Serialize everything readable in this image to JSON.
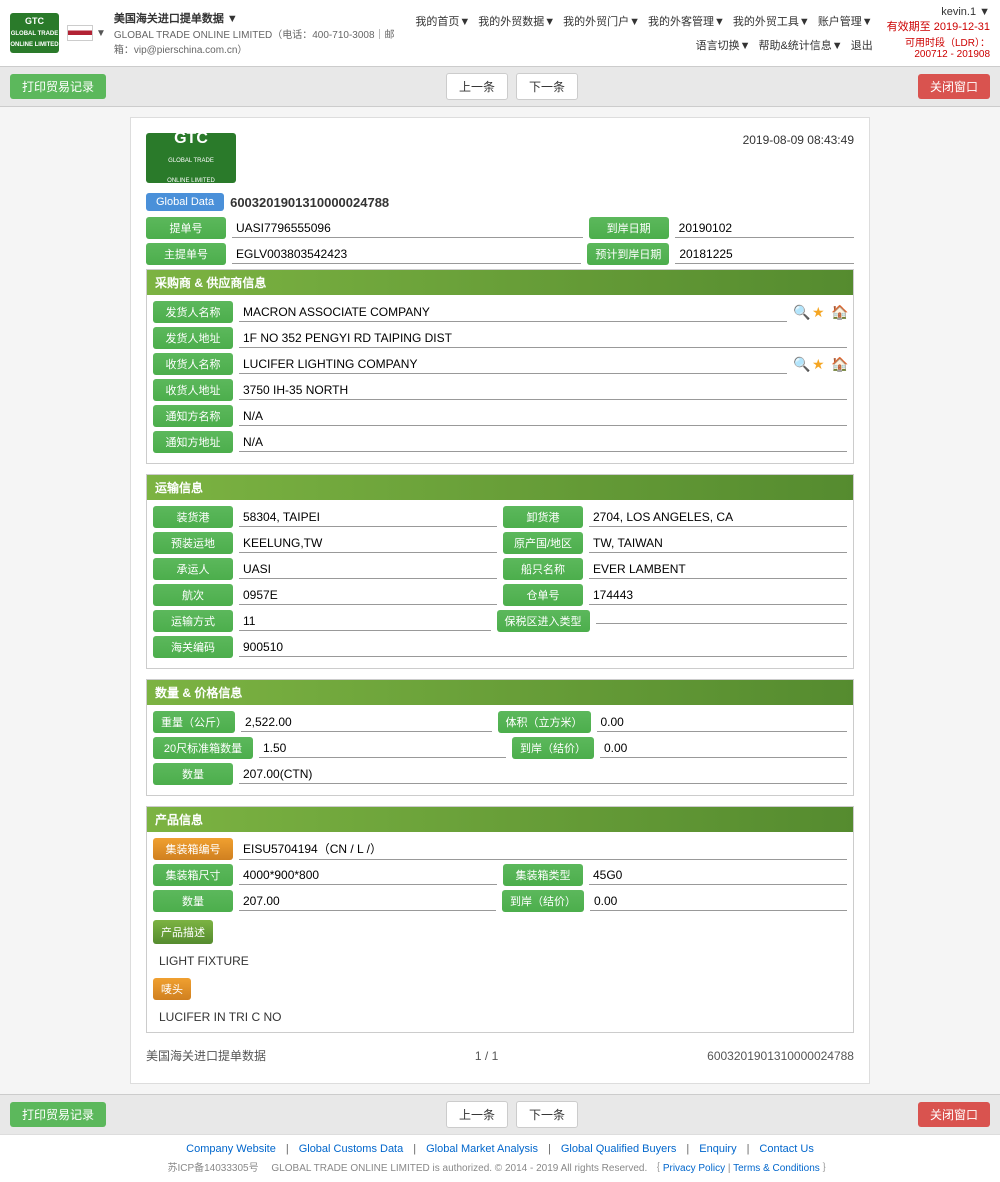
{
  "header": {
    "logo_line1": "GLOBAL TRADE",
    "logo_line2": "ONLINE LIMITED",
    "company_info": "GLOBAL TRADE ONLINE LIMITED（电话：400-710-3008｜邮箱：vip@pierschina.com.cn）",
    "page_title": "美国海关进口提单数据 ▼",
    "account": "kevin.1 ▼",
    "validity": "有效期至 2019-12-31",
    "ldr": "可用时段（LDR）：200712 - 201908",
    "flag_alt": "US Flag"
  },
  "nav": {
    "items": [
      "我的首页▼",
      "我的外贸数据▼",
      "我的外贸门户▼",
      "我的外客管理▼",
      "我的外贸工具▼",
      "账户管理▼",
      "语言切换▼",
      "帮助&统计信息▼",
      "退出"
    ]
  },
  "toolbar": {
    "print_btn": "打印贸易记录",
    "prev_btn": "上一条",
    "next_btn": "下一条",
    "close_btn": "关闭窗口"
  },
  "doc": {
    "timestamp": "2019-08-09 08:43:49",
    "logo_line1": "GTC",
    "logo_line2": "GLOBAL TRADE ONLINE LIMITED",
    "global_data_label": "Global Data",
    "global_data_value": "6003201901310000024788",
    "bill_no_label": "提单号",
    "bill_no_value": "UASI7796555096",
    "arrival_date_label": "到岸日期",
    "arrival_date_value": "20190102",
    "main_bill_label": "主提单号",
    "main_bill_value": "EGLV003803542423",
    "est_arrival_label": "预计到岸日期",
    "est_arrival_value": "20181225"
  },
  "buyer_supplier": {
    "section_title": "采购商 & 供应商信息",
    "shipper_name_label": "发货人名称",
    "shipper_name_value": "MACRON ASSOCIATE COMPANY",
    "shipper_addr_label": "发货人地址",
    "shipper_addr_value": "1F NO 352 PENGYI RD TAIPING DIST",
    "consignee_name_label": "收货人名称",
    "consignee_name_value": "LUCIFER LIGHTING COMPANY",
    "consignee_addr_label": "收货人地址",
    "consignee_addr_value": "3750 IH-35 NORTH",
    "notify_name_label": "通知方名称",
    "notify_name_value": "N/A",
    "notify_addr_label": "通知方地址",
    "notify_addr_value": "N/A"
  },
  "transport": {
    "section_title": "运输信息",
    "load_port_label": "装货港",
    "load_port_value": "58304, TAIPEI",
    "discharge_port_label": "卸货港",
    "discharge_port_value": "2704, LOS ANGELES, CA",
    "preload_label": "预装运地",
    "preload_value": "KEELUNG,TW",
    "origin_label": "原产国/地区",
    "origin_value": "TW, TAIWAN",
    "carrier_label": "承运人",
    "carrier_value": "UASI",
    "vessel_label": "船只名称",
    "vessel_value": "EVER LAMBENT",
    "voyage_label": "航次",
    "voyage_value": "0957E",
    "warehouse_label": "仓单号",
    "warehouse_value": "174443",
    "transport_label": "运输方式",
    "transport_value": "11",
    "bonded_label": "保税区进入类型",
    "bonded_value": "",
    "customs_label": "海关编码",
    "customs_value": "900510"
  },
  "quantity_price": {
    "section_title": "数量 & 价格信息",
    "weight_label": "重量（公斤）",
    "weight_value": "2,522.00",
    "volume_label": "体积（立方米）",
    "volume_value": "0.00",
    "container20_label": "20尺标准箱数量",
    "container20_value": "1.50",
    "unit_price_label": "到岸（结价）",
    "unit_price_value": "0.00",
    "quantity_label": "数量",
    "quantity_value": "207.00(CTN)"
  },
  "product": {
    "section_title": "产品信息",
    "container_no_label": "集装箱编号",
    "container_no_value": "EISU5704194（CN / L /）",
    "container_size_label": "集装箱尺寸",
    "container_size_value": "4000*900*800",
    "container_type_label": "集装箱类型",
    "container_type_value": "45G0",
    "quantity_label": "数量",
    "quantity_value": "207.00",
    "unit_price_label": "到岸（结价）",
    "unit_price_value": "0.00",
    "desc_section_label": "产品描述",
    "desc_value": "LIGHT FIXTURE",
    "mark_section_label": "唛头",
    "mark_value": "LUCIFER IN TRI C NO"
  },
  "pagination": {
    "source_label": "美国海关进口提单数据",
    "page_info": "1 / 1",
    "record_no": "6003201901310000024788"
  },
  "footer": {
    "icp": "苏ICP备14033305号",
    "links": [
      "Company Website",
      "Global Customs Data",
      "Global Market Analysis",
      "Global Qualified Buyers",
      "Enquiry",
      "Contact Us"
    ],
    "copyright": "GLOBAL TRADE ONLINE LIMITED is authorized. © 2014 - 2019 All rights Reserved.｛",
    "privacy": "Privacy Policy",
    "separator": "|",
    "terms": "Terms & Conditions",
    "copy_end": "｝"
  }
}
